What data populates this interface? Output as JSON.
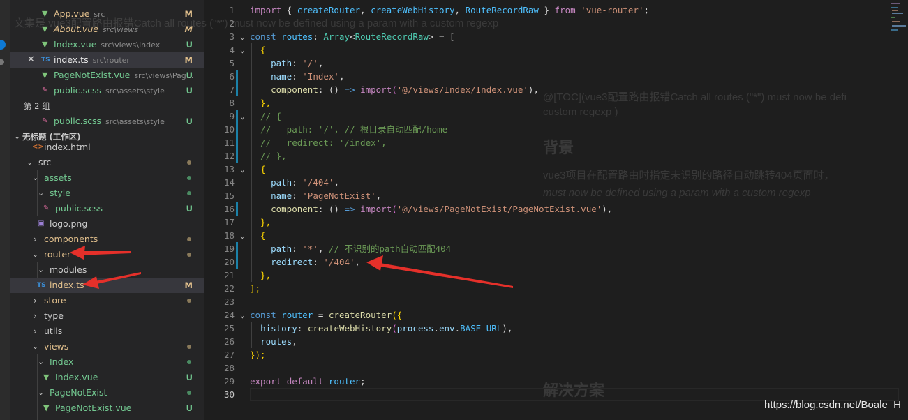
{
  "sidebar": {
    "group2_label": "第 2 组",
    "workspace_label": "无标题 (工作区)",
    "open_editors": [
      {
        "name": "App.vue",
        "path": "src",
        "badge": "M"
      },
      {
        "name": "About.vue",
        "path": "src\\views",
        "badge": "M"
      },
      {
        "name": "Index.vue",
        "path": "src\\views\\Index",
        "badge": "U"
      },
      {
        "name": "index.ts",
        "path": "src\\router",
        "badge": "M"
      },
      {
        "name": "PageNotExist.vue",
        "path": "src\\views\\Pag...",
        "badge": "U"
      },
      {
        "name": "public.scss",
        "path": "src\\assets\\style",
        "badge": "U"
      },
      {
        "name": "public.scss",
        "path": "src\\assets\\style",
        "badge": "U"
      }
    ],
    "tree": [
      {
        "name": "index.html"
      },
      {
        "name": "src"
      },
      {
        "name": "assets"
      },
      {
        "name": "style"
      },
      {
        "name": "public.scss",
        "badge": "U"
      },
      {
        "name": "logo.png"
      },
      {
        "name": "components"
      },
      {
        "name": "router"
      },
      {
        "name": "modules"
      },
      {
        "name": "index.ts",
        "badge": "M"
      },
      {
        "name": "store"
      },
      {
        "name": "type"
      },
      {
        "name": "utils"
      },
      {
        "name": "views"
      },
      {
        "name": "Index"
      },
      {
        "name": "Index.vue",
        "badge": "U"
      },
      {
        "name": "PageNotExist"
      },
      {
        "name": "PageNotExist.vue",
        "badge": "U"
      }
    ]
  },
  "editor": {
    "line_numbers": [
      "1",
      "2",
      "3",
      "4",
      "5",
      "6",
      "7",
      "8",
      "9",
      "10",
      "11",
      "12",
      "13",
      "14",
      "15",
      "16",
      "17",
      "18",
      "19",
      "20",
      "21",
      "22",
      "23",
      "24",
      "25",
      "26",
      "27",
      "28",
      "29",
      "30"
    ],
    "code": {
      "l1": [
        "import",
        " { ",
        "createRouter",
        ", ",
        "createWebHistory",
        ", ",
        "RouteRecordRaw",
        " } ",
        "from",
        " ",
        "'vue-router'",
        ";"
      ],
      "l3": [
        "const",
        " ",
        "routes",
        ": ",
        "Array",
        "<",
        "RouteRecordRaw",
        "> = ["
      ],
      "l4": "  {",
      "l5": [
        "    ",
        "path",
        ": ",
        "'/'",
        ","
      ],
      "l6": [
        "    ",
        "name",
        ": ",
        "'Index'",
        ","
      ],
      "l7": [
        "    ",
        "component",
        ": () ",
        "=>",
        " ",
        "import",
        "(",
        "'@/views/Index/Index.vue'",
        "),"
      ],
      "l8": "  },",
      "l9": "  // {",
      "l10": "  //   path: '/', // 根目录自动匹配/home",
      "l11": "  //   redirect: '/index',",
      "l12": "  // },",
      "l13": "  {",
      "l14": [
        "    ",
        "path",
        ": ",
        "'/404'",
        ","
      ],
      "l15": [
        "    ",
        "name",
        ": ",
        "'PageNotExist'",
        ","
      ],
      "l16": [
        "    ",
        "component",
        ": () ",
        "=>",
        " ",
        "import",
        "(",
        "'@/views/PageNotExist/PageNotExist.vue'",
        "),"
      ],
      "l17": "  },",
      "l18": "  {",
      "l19": [
        "    ",
        "path",
        ": ",
        "'*'",
        ", ",
        "// 不识别的path自动匹配404"
      ],
      "l20": [
        "    ",
        "redirect",
        ": ",
        "'/404'",
        ","
      ],
      "l21": "  },",
      "l22": "];",
      "l24": [
        "const",
        " ",
        "router",
        " = ",
        "createRouter",
        "({"
      ],
      "l25": [
        "  ",
        "history",
        ": ",
        "createWebHistory",
        "(",
        "process",
        ".",
        "env",
        ".",
        "BASE_URL",
        "),"
      ],
      "l26": [
        "  ",
        "routes",
        ","
      ],
      "l27": "});",
      "l29": [
        "export",
        " ",
        "default",
        " ",
        "router",
        ";"
      ]
    }
  },
  "ghost_text": {
    "top": "文集是 vue3配置路由报错Catch all routes (\"*\") must now be defined using a param with a custom regexp",
    "toc": "@[TOC](vue3配置路由报错Catch all routes (\"*\") must now be defi",
    "custom": "custom regexp )",
    "bg_heading": "背景",
    "bg_line": "vue3项目在配置路由时指定未识别的路径自动跳转404页面时，",
    "bg_line2": "must now be defined using a param with a custom regexp",
    "solution": "解决方案"
  },
  "watermark": "https://blog.csdn.net/Boale_H"
}
